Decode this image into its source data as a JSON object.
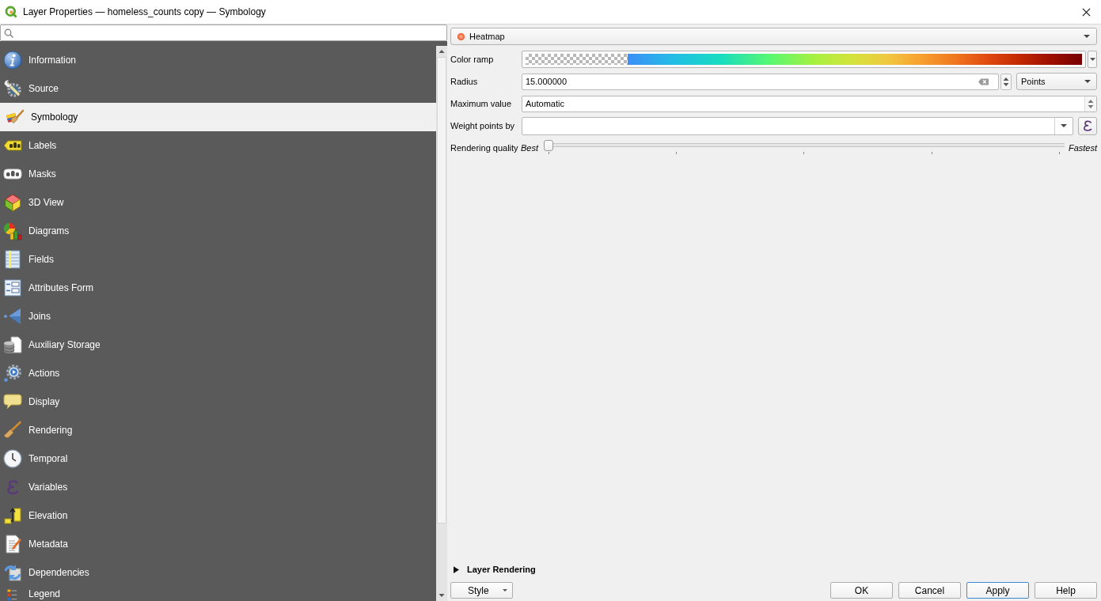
{
  "window": {
    "title": "Layer Properties — homeless_counts copy — Symbology"
  },
  "sidebar": {
    "items": [
      {
        "label": "Information",
        "selected": false
      },
      {
        "label": "Source",
        "selected": false
      },
      {
        "label": "Symbology",
        "selected": true
      },
      {
        "label": "Labels",
        "selected": false
      },
      {
        "label": "Masks",
        "selected": false
      },
      {
        "label": "3D View",
        "selected": false
      },
      {
        "label": "Diagrams",
        "selected": false
      },
      {
        "label": "Fields",
        "selected": false
      },
      {
        "label": "Attributes Form",
        "selected": false
      },
      {
        "label": "Joins",
        "selected": false
      },
      {
        "label": "Auxiliary Storage",
        "selected": false
      },
      {
        "label": "Actions",
        "selected": false
      },
      {
        "label": "Display",
        "selected": false
      },
      {
        "label": "Rendering",
        "selected": false
      },
      {
        "label": "Temporal",
        "selected": false
      },
      {
        "label": "Variables",
        "selected": false
      },
      {
        "label": "Elevation",
        "selected": false
      },
      {
        "label": "Metadata",
        "selected": false
      },
      {
        "label": "Dependencies",
        "selected": false
      },
      {
        "label": "Legend",
        "selected": false
      }
    ]
  },
  "renderer": {
    "value": "Heatmap"
  },
  "form": {
    "rows": [
      {
        "kind": "ramp",
        "label": "Color ramp"
      },
      {
        "kind": "spin_unit",
        "label": "Radius",
        "value": "15.000000",
        "unit": "Points"
      },
      {
        "kind": "spin",
        "label": "Maximum value",
        "value": "Automatic"
      },
      {
        "kind": "expression_combo",
        "label": "Weight points by"
      },
      {
        "kind": "slider",
        "label": "Rendering quality",
        "min_label": "Best",
        "max_label": "Fastest",
        "level": 0
      }
    ]
  },
  "layer_rendering": {
    "label": "Layer Rendering",
    "expanded": false
  },
  "style_button": {
    "label": "Style"
  },
  "buttons": [
    {
      "label": "OK",
      "default": false
    },
    {
      "label": "Cancel",
      "default": false
    },
    {
      "label": "Apply",
      "default": true
    },
    {
      "label": "Help",
      "default": false
    }
  ]
}
